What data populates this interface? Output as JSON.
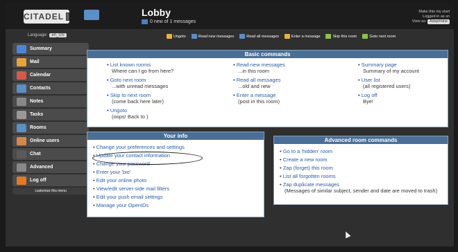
{
  "header": {
    "logo_text": "CITADEL",
    "room_title": "Lobby",
    "room_subtitle": "0 new of 1 messages",
    "user_line1": "Make this my start",
    "user_line2": "Logged in as sn",
    "view_as_label": "View as:",
    "view_as_value": "Adsp/mine"
  },
  "language": {
    "label": "Language:",
    "value": "en_US"
  },
  "toolbar": [
    {
      "label": "Ungoto",
      "icon": "ungoto-icon",
      "color": "#e9b23a"
    },
    {
      "label": "Read new messages",
      "icon": "read-new-icon",
      "color": "#5a8fc8"
    },
    {
      "label": "Read all messages",
      "icon": "read-all-icon",
      "color": "#5a8fc8"
    },
    {
      "label": "Enter a message",
      "icon": "pencil-icon",
      "color": "#e9b23a"
    },
    {
      "label": "Skip this room",
      "icon": "skip-icon",
      "color": "#8bc34a"
    },
    {
      "label": "Goto next room",
      "icon": "next-icon",
      "color": "#8bc34a"
    }
  ],
  "sidebar": [
    {
      "label": "Summary",
      "icon": "summary-icon",
      "color": "#4b86d6"
    },
    {
      "label": "Mail",
      "icon": "mail-icon",
      "color": "#e9a23a"
    },
    {
      "label": "Calendar",
      "icon": "calendar-icon",
      "color": "#d65a4b"
    },
    {
      "label": "Contacts",
      "icon": "contacts-icon",
      "color": "#5a8fc8"
    },
    {
      "label": "Notes",
      "icon": "notes-icon",
      "color": "#888"
    },
    {
      "label": "Tasks",
      "icon": "tasks-icon",
      "color": "#999"
    },
    {
      "label": "Rooms",
      "icon": "rooms-icon",
      "color": "#5a8fc8"
    },
    {
      "label": "Online users",
      "icon": "online-users-icon",
      "color": "#d6874b"
    },
    {
      "label": "Chat",
      "icon": "chat-icon",
      "color": "#5a5a5a"
    },
    {
      "label": "Advanced",
      "icon": "gear-icon",
      "color": "#888"
    },
    {
      "label": "Log off",
      "icon": "log-off-icon",
      "color": "#e07a2a"
    },
    {
      "label": "customize this menu",
      "icon": "",
      "color": ""
    }
  ],
  "basic": {
    "title": "Basic commands",
    "col1": [
      {
        "link": "List known rooms",
        "desc": "Where can I go from here?"
      },
      {
        "link": "Goto next room",
        "desc": "...with unread messages"
      },
      {
        "link": "Skip to next room",
        "desc": "(come back here later)"
      },
      {
        "link": "Ungoto",
        "desc": "(oops! Back to )"
      }
    ],
    "col2": [
      {
        "link": "Read new messages",
        "desc": "...in this room"
      },
      {
        "link": "Read all messages",
        "desc": "...old and new"
      },
      {
        "link": "Enter a message",
        "desc": "(post in this room)"
      }
    ],
    "col3": [
      {
        "link": "Summary page",
        "desc": "Summary of my account"
      },
      {
        "link": "User list",
        "desc": "(all registered users)"
      },
      {
        "link": "Log off",
        "desc": "Bye!"
      }
    ]
  },
  "yourinfo": {
    "title": "Your info",
    "items": [
      "Change your preferences and settings",
      "Update your contact information",
      "Change your password",
      "Enter your 'bio'",
      "Edit your online photo",
      "View/edit server-side mail filters",
      "Edit your push email settings",
      "Manage your OpenIDs"
    ]
  },
  "advanced": {
    "title": "Advanced room commands",
    "items": [
      "Go to a 'hidden' room",
      "Create a new room",
      "Zap (forget) this room",
      "List all forgotten rooms",
      "Zap duplicate messages"
    ],
    "note": "(Messages of similar subject, sender and date are moved to trash)"
  }
}
